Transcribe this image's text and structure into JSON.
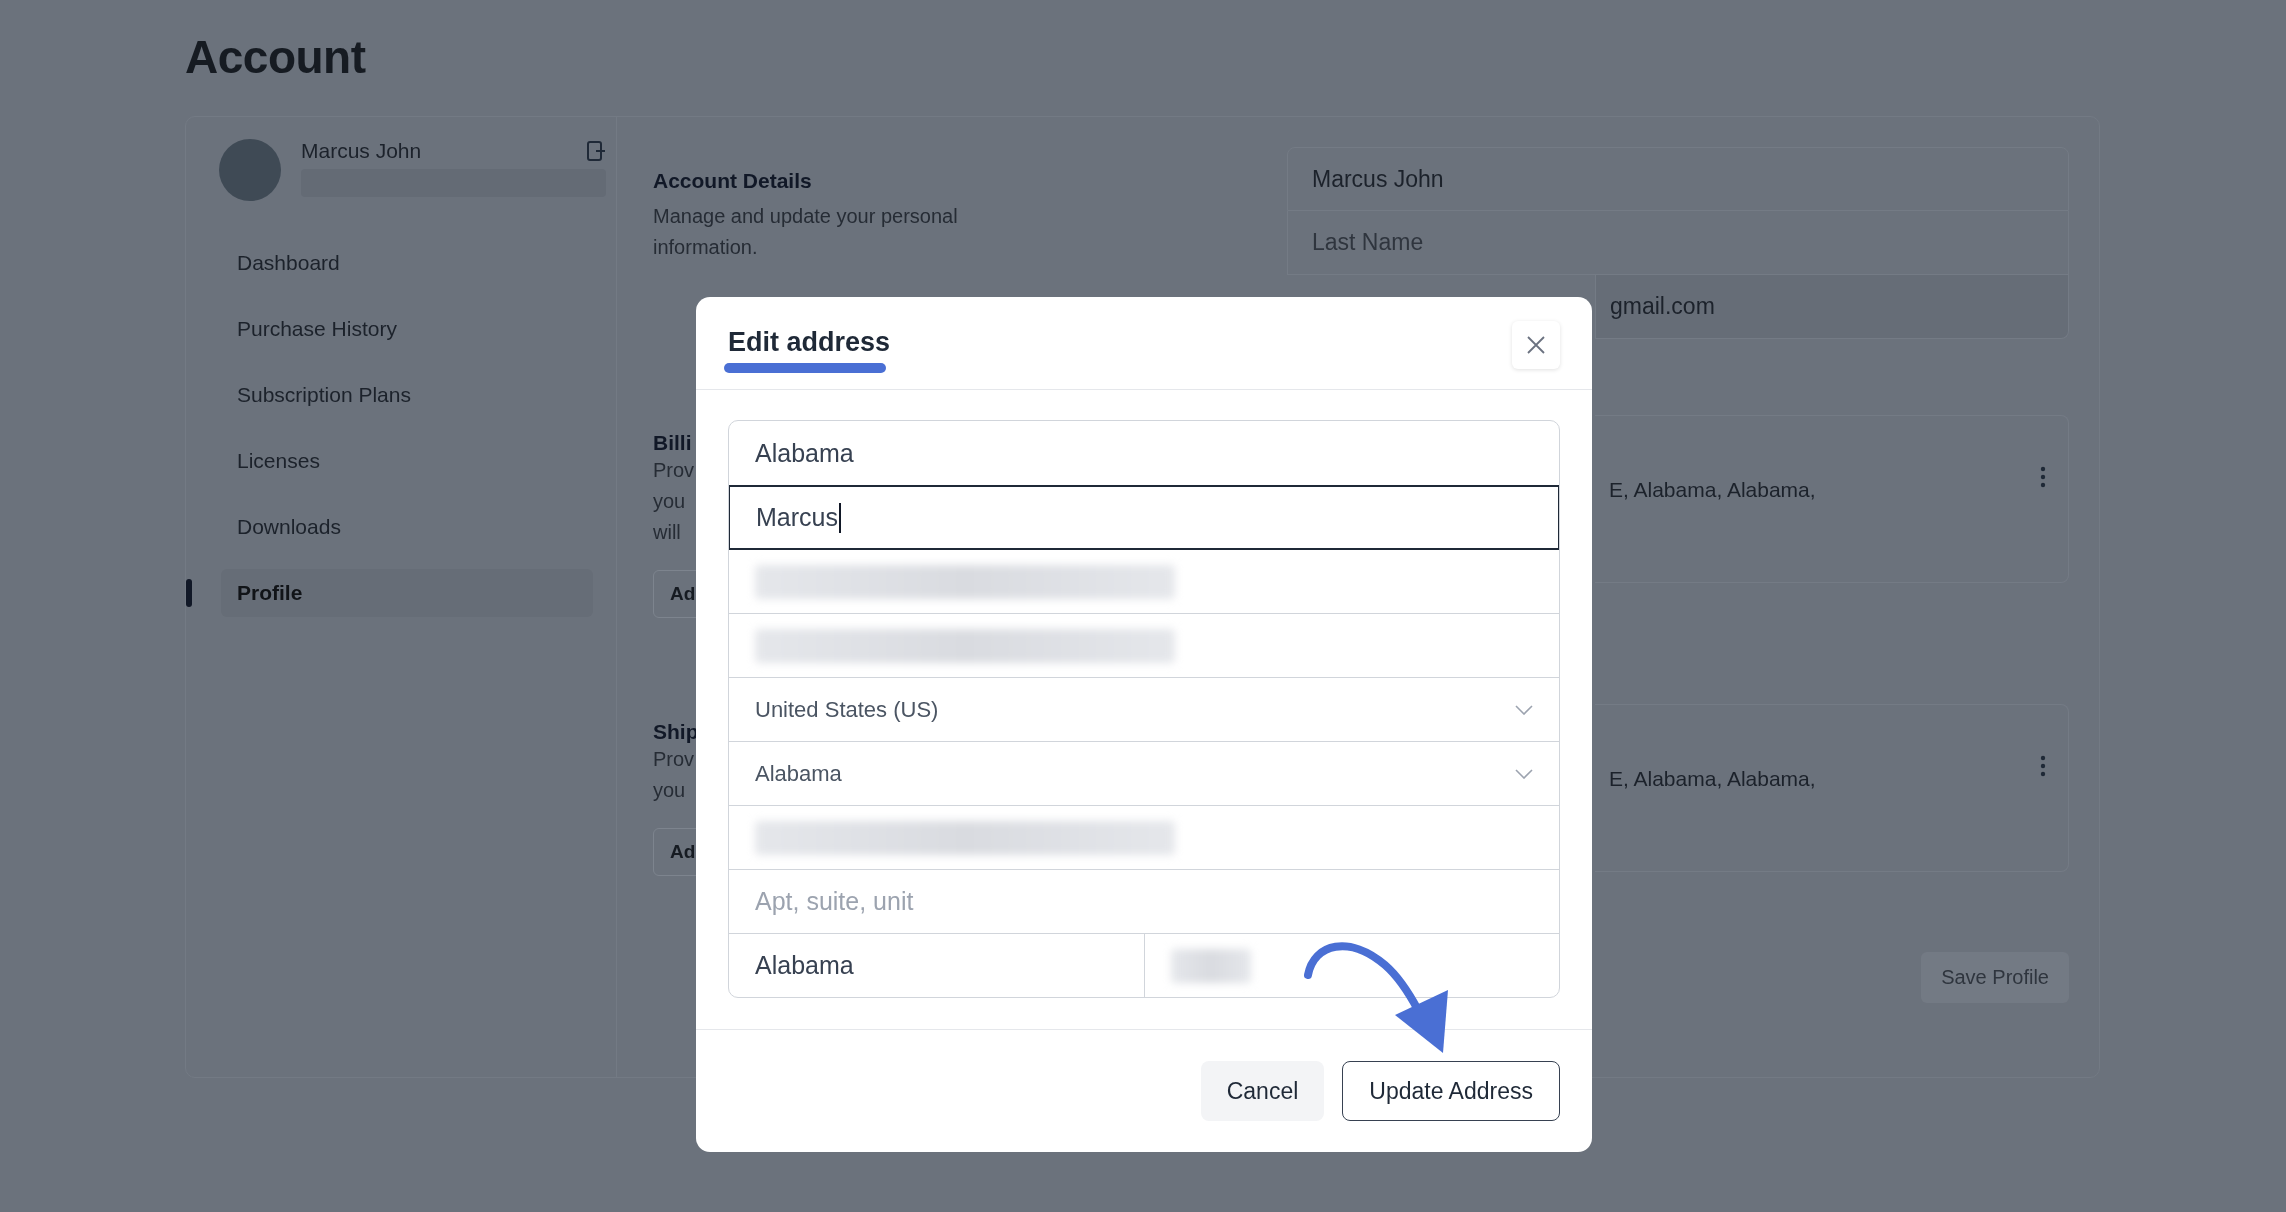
{
  "page": {
    "title": "Account"
  },
  "sidebar": {
    "user": {
      "name": "Marcus John"
    },
    "items": [
      {
        "label": "Dashboard",
        "selected": false
      },
      {
        "label": "Purchase History",
        "selected": false
      },
      {
        "label": "Subscription Plans",
        "selected": false
      },
      {
        "label": "Licenses",
        "selected": false
      },
      {
        "label": "Downloads",
        "selected": false
      },
      {
        "label": "Profile",
        "selected": true
      }
    ]
  },
  "account_details": {
    "heading": "Account Details",
    "description": "Manage and update your personal information.",
    "fields": [
      {
        "value": "Marcus John"
      },
      {
        "placeholder": "Last Name"
      },
      {
        "value": "gmail.com"
      }
    ]
  },
  "sections": [
    {
      "heading": "Billi",
      "description_lines": [
        "Prov",
        "you",
        "will"
      ],
      "button": "Ad",
      "address": "E, Alabama, Alabama,"
    },
    {
      "heading": "Ship",
      "description_lines": [
        "Prov",
        "you"
      ],
      "button": "Ad",
      "address": "E, Alabama, Alabama,"
    }
  ],
  "save_button": "Save Profile",
  "modal": {
    "title": "Edit address",
    "fields": [
      {
        "kind": "text",
        "value": "Alabama",
        "focused": false
      },
      {
        "kind": "text",
        "value": "Marcus",
        "focused": true
      },
      {
        "kind": "redacted",
        "focused": false
      },
      {
        "kind": "redacted",
        "focused": false
      },
      {
        "kind": "select",
        "value": "United States (US)",
        "focused": false
      },
      {
        "kind": "select",
        "value": "Alabama",
        "focused": false
      },
      {
        "kind": "redacted",
        "focused": false
      },
      {
        "kind": "text",
        "placeholder": "Apt, suite, unit",
        "focused": false
      },
      {
        "kind": "split",
        "value": "Alabama",
        "focused": false
      }
    ],
    "buttons": {
      "cancel": "Cancel",
      "submit": "Update Address"
    }
  }
}
